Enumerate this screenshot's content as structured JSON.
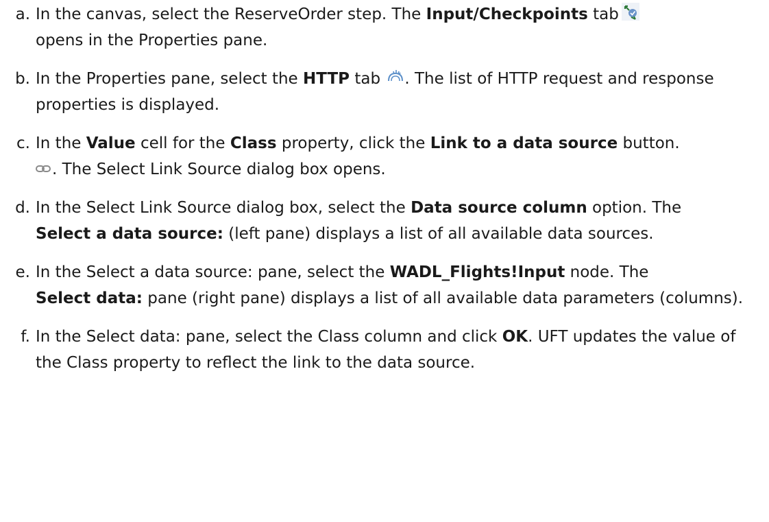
{
  "steps": [
    {
      "marker": "a.",
      "parts": [
        "In the canvas, select the ReserveOrder step. The ",
        "Input/Checkpoints",
        " tab",
        " opens in the Properties pane."
      ],
      "icon": "input-checkpoints-tab-icon"
    },
    {
      "marker": "b.",
      "parts": [
        "In the Properties pane, select the ",
        "HTTP",
        " tab",
        ". The list of HTTP request and response properties is displayed."
      ],
      "icon": "http-tab-icon"
    },
    {
      "marker": "c.",
      "parts": [
        "In the ",
        "Value",
        " cell for the ",
        "Class",
        " property, click the ",
        "Link to a data source",
        " button.",
        ". The Select Link Source dialog box opens."
      ],
      "icon": "link-to-data-source-icon"
    },
    {
      "marker": "d.",
      "parts": [
        "In the Select Link Source dialog box, select the ",
        "Data source column",
        " option. The ",
        "Select a data source:",
        " (left pane) displays a list of all available data sources."
      ]
    },
    {
      "marker": "e.",
      "parts": [
        "In the Select a data source: pane, select the ",
        "WADL_Flights!Input",
        " node. The ",
        "Select data:",
        " pane (right pane) displays a list of all available data parameters (columns)."
      ]
    },
    {
      "marker": "f.",
      "parts": [
        "In the Select data: pane, select the Class column and click ",
        "OK",
        ". UFT updates the value of the Class property to reflect the link to the data source."
      ]
    }
  ]
}
